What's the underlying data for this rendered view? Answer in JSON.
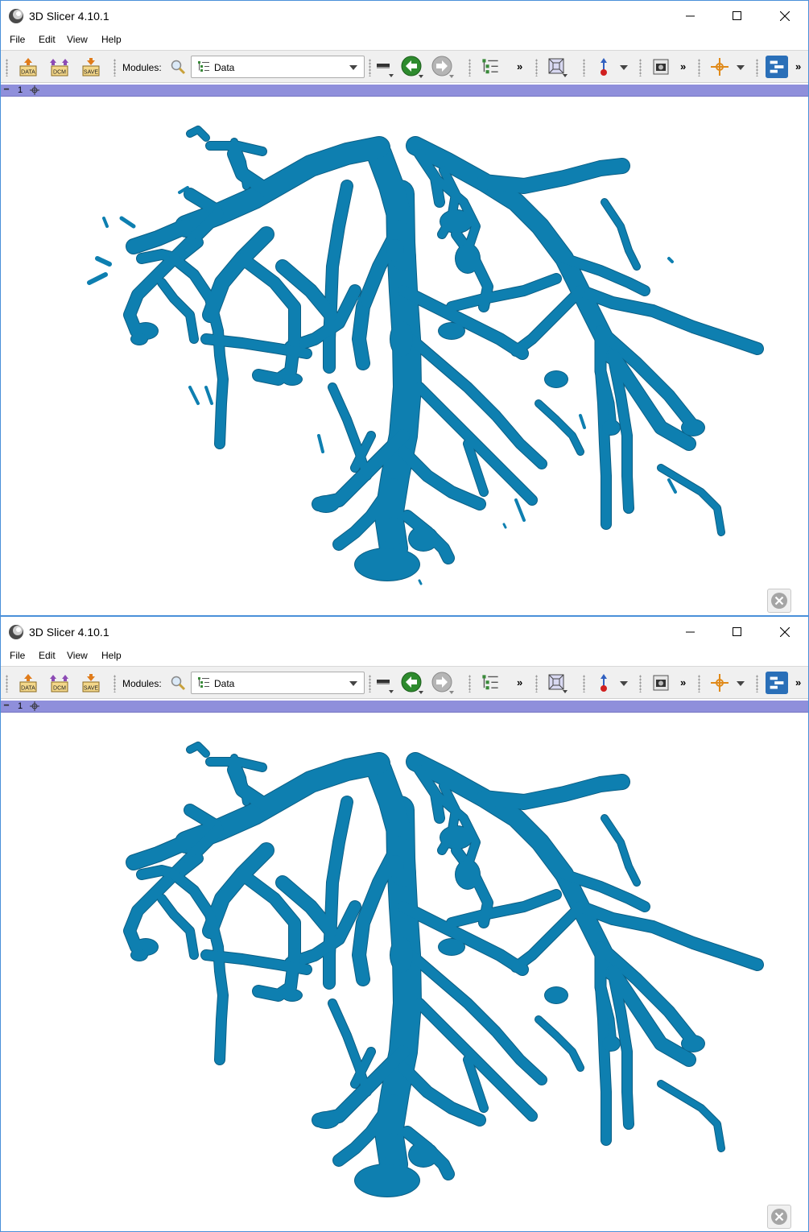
{
  "windows": [
    {
      "id": "top",
      "title": "3D Slicer 4.10.1",
      "menu": [
        "File",
        "Edit",
        "View",
        "Help"
      ],
      "toolbar": {
        "data_icon_label": "DATA",
        "dcm_icon_label": "DCM",
        "save_icon_label": "SAVE",
        "modules_label": "Modules:",
        "module_selected": "Data",
        "more": "»"
      },
      "view": {
        "number": "1",
        "variant": "full",
        "stray_fragments": "visible"
      }
    },
    {
      "id": "bottom",
      "title": "3D Slicer 4.10.1",
      "menu": [
        "File",
        "Edit",
        "View",
        "Help"
      ],
      "toolbar": {
        "data_icon_label": "DATA",
        "dcm_icon_label": "DCM",
        "save_icon_label": "SAVE",
        "modules_label": "Modules:",
        "module_selected": "Data",
        "more": "»"
      },
      "view": {
        "number": "1",
        "variant": "cleaned",
        "stray_fragments": "removed"
      }
    }
  ],
  "colors": {
    "vessel": "#0e7fb0",
    "vessel_dark": "#0a5f86",
    "view_bar": "#8f8fdb",
    "window_border": "#4a90d9",
    "nav_back": "#2e8b2e",
    "nav_forward": "#9a9a9a"
  },
  "icons": [
    "app-logo-icon",
    "minimize-icon",
    "maximize-icon",
    "close-icon",
    "load-data-icon",
    "load-dicom-icon",
    "save-icon",
    "search-icon",
    "module-list-icon",
    "layout-icon",
    "back-arrow-icon",
    "forward-arrow-icon",
    "data-tree-icon",
    "3d-view-icon",
    "markup-icon",
    "screenshot-icon",
    "crosshair-icon",
    "extensions-icon",
    "pin-icon",
    "view-close-icon"
  ]
}
